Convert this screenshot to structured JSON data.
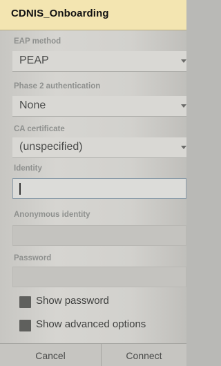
{
  "dialog": {
    "title": "CDNIS_Onboarding"
  },
  "fields": {
    "eap_method": {
      "label": "EAP method",
      "value": "PEAP"
    },
    "phase2": {
      "label": "Phase 2 authentication",
      "value": "None"
    },
    "ca_cert": {
      "label": "CA certificate",
      "value": "(unspecified)"
    },
    "identity": {
      "label": "Identity",
      "value": ""
    },
    "anonymous_identity": {
      "label": "Anonymous identity",
      "value": ""
    },
    "password": {
      "label": "Password",
      "value": ""
    }
  },
  "options": {
    "show_password": {
      "label": "Show password",
      "checked": false
    },
    "show_advanced": {
      "label": "Show advanced options",
      "checked": false
    }
  },
  "buttons": {
    "cancel": "Cancel",
    "connect": "Connect"
  },
  "colors": {
    "title_bar": "#f3e5b1",
    "background": "#d2d1cd",
    "checkbox": "#5f605d"
  }
}
